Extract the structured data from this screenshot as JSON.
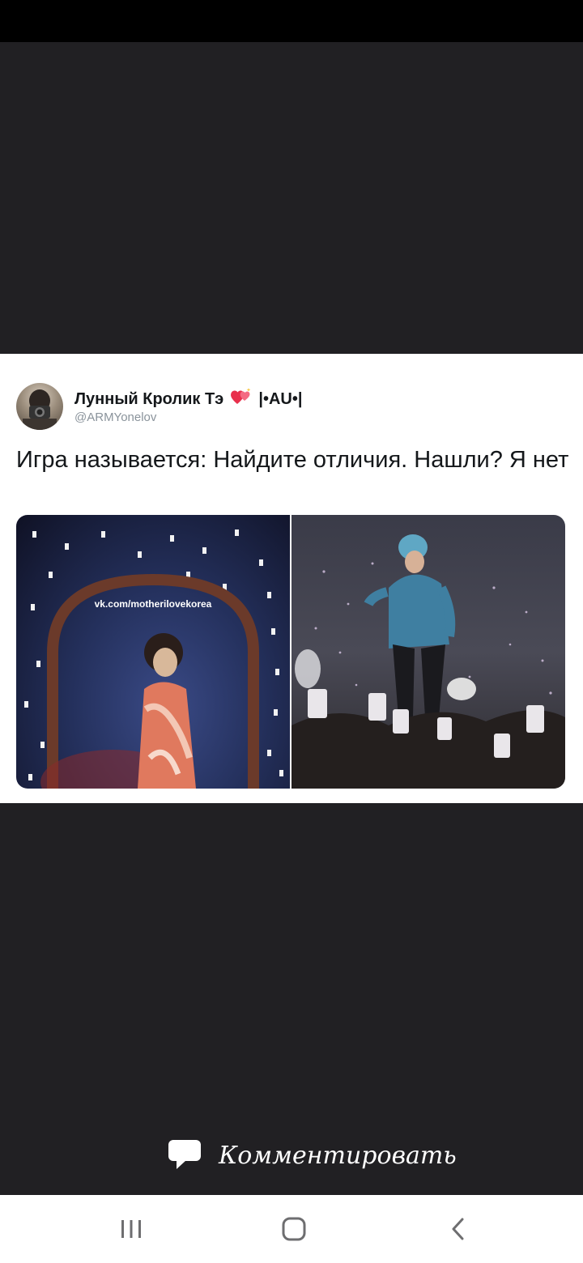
{
  "tweet": {
    "display_name": "Лунный Кролик Тэ",
    "name_suffix": "|•AU•|",
    "handle": "@ARMYonelov",
    "text": "Игра называется: Найдите отличия. Нашли? Я нет",
    "media": {
      "left_watermark": "vk.com/motherilovekorea"
    }
  },
  "footer": {
    "comment_label": "Комментировать"
  },
  "nav": {
    "icons": [
      "recent-apps-icon",
      "home-icon",
      "back-icon"
    ]
  },
  "colors": {
    "background": "#212023",
    "card": "#ffffff",
    "name_text": "#14171a",
    "handle_text": "#8a939b"
  }
}
